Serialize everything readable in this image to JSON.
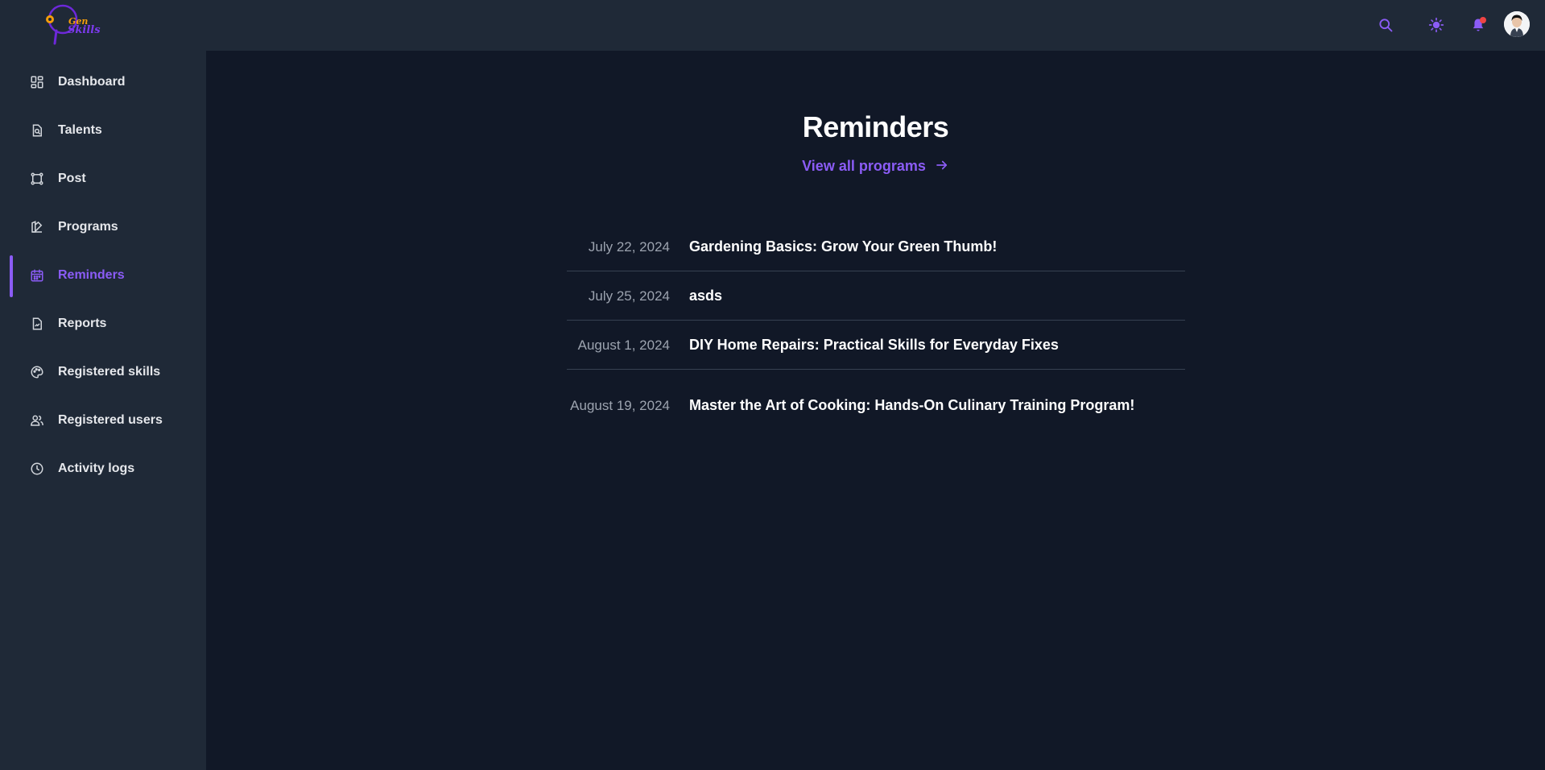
{
  "brand": {
    "line1": "Gen",
    "line2": "Skills"
  },
  "topbar": {
    "icons": [
      "search-icon",
      "sun-icon",
      "bell-icon"
    ]
  },
  "sidebar": {
    "items": [
      {
        "label": "Dashboard",
        "icon": "dashboard-icon"
      },
      {
        "label": "Talents",
        "icon": "talents-icon"
      },
      {
        "label": "Post",
        "icon": "post-icon"
      },
      {
        "label": "Programs",
        "icon": "programs-icon"
      },
      {
        "label": "Reminders",
        "icon": "calendar-icon",
        "active": true
      },
      {
        "label": "Reports",
        "icon": "reports-icon"
      },
      {
        "label": "Registered skills",
        "icon": "palette-icon"
      },
      {
        "label": "Registered users",
        "icon": "users-icon"
      },
      {
        "label": "Activity logs",
        "icon": "clock-icon"
      }
    ]
  },
  "main": {
    "title": "Reminders",
    "view_all_label": "View all programs",
    "reminders": [
      {
        "date": "July 22, 2024",
        "title": "Gardening Basics: Grow Your Green Thumb!"
      },
      {
        "date": "July 25, 2024",
        "title": "asds"
      },
      {
        "date": "August 1, 2024",
        "title": "DIY Home Repairs: Practical Skills for Everyday Fixes"
      },
      {
        "date": "August 19, 2024",
        "title": "Master the Art of Cooking: Hands-On Culinary Training Program!"
      }
    ]
  },
  "colors": {
    "accent": "#8b5cf6",
    "background": "#111827",
    "panel": "#1f2937",
    "notification": "#ef4444"
  }
}
